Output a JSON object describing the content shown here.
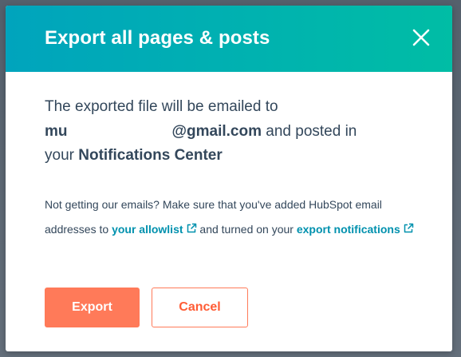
{
  "modal": {
    "title": "Export all pages & posts",
    "message": {
      "line1": "The exported file will be emailed to",
      "email_prefix": "mu",
      "email_suffix": "@gmail.com",
      "after_email": " and posted in",
      "your": "your ",
      "notifications_center": "Notifications Center"
    },
    "note": {
      "text1": "Not getting our emails? Make sure that you've added HubSpot email addresses to ",
      "allowlist_link": "your allowlist",
      "text2": " and turned on your ",
      "export_notifications_link": "export notifications"
    },
    "buttons": {
      "export": "Export",
      "cancel": "Cancel"
    }
  },
  "icons": {
    "close": "close-icon",
    "external_link": "external-link-icon"
  },
  "colors": {
    "header_gradient_start": "#00a4bd",
    "header_gradient_end": "#00bda5",
    "primary_button": "#ff7a59",
    "link": "#0091ae",
    "text": "#33475b"
  }
}
